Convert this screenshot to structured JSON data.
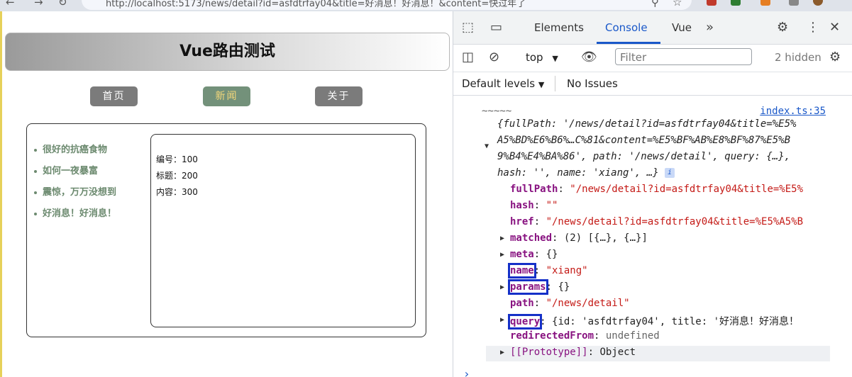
{
  "browser": {
    "url": "http://localhost:5173/news/detail?id=asfdtrfay04&title=好消息！好消息！&content=快过年了"
  },
  "app": {
    "title": "Vue路由测试",
    "nav": [
      {
        "label": "首页",
        "active": false
      },
      {
        "label": "新闻",
        "active": true
      },
      {
        "label": "关于",
        "active": false
      }
    ],
    "news": [
      "很好的抗癌食物",
      "如何一夜暴富",
      "震惊，万万没想到",
      "好消息！好消息！"
    ],
    "detail": [
      "编号：100",
      "标题：200",
      "内容：300"
    ]
  },
  "devtools": {
    "tabs": [
      "Elements",
      "Console",
      "Vue"
    ],
    "active_tab": "Console",
    "context": "top",
    "filter_placeholder": "Filter",
    "hidden_count": "2 hidden",
    "levels": "Default levels",
    "issues": "No Issues",
    "source": "index.ts:35",
    "log_prefix": "~~~~~",
    "summary": {
      "l1": "{fullPath: '/news/detail?id=asfdtrfay04&title=%E5%",
      "l2": "A5%BD%E6%B6%…C%81&content=%E5%BF%AB%E8%BF%87%E5%B",
      "l3": "9%B4%E4%BA%86', path: '/news/detail', query: {…},",
      "l4": "hash: '', name: 'xiang', …}"
    },
    "props": [
      {
        "key": "fullPath",
        "value": "\"/news/detail?id=asfdtrfay04&title=%E5%"
      },
      {
        "key": "hash",
        "value": "\"\""
      },
      {
        "key": "href",
        "value": "\"/news/detail?id=asfdtrfay04&title=%E5%A5%B"
      },
      {
        "key": "matched",
        "value": "(2) [{…}, {…}]"
      },
      {
        "key": "meta",
        "value": "{}"
      },
      {
        "key": "name",
        "value": "\"xiang\""
      },
      {
        "key": "params",
        "value": "{}"
      },
      {
        "key": "path",
        "value": "\"/news/detail\""
      },
      {
        "key": "query",
        "value": "{id: 'asfdtrfay04', title: '好消息！好消息！"
      },
      {
        "key": "redirectedFrom",
        "value": "undefined"
      },
      {
        "key": "[[Prototype]]",
        "value": "Object"
      }
    ]
  }
}
